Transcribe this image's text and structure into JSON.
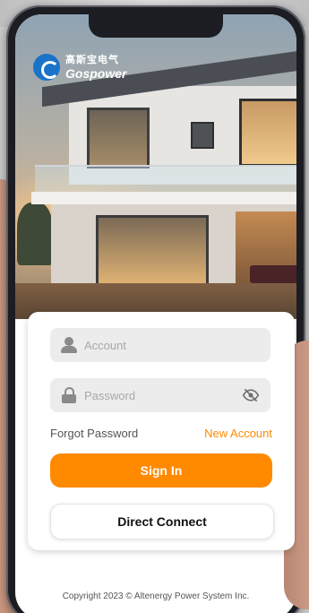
{
  "brand": {
    "name_cn": "高斯宝电气",
    "name_en": "Gospower"
  },
  "login": {
    "account_placeholder": "Account",
    "password_placeholder": "Password",
    "forgot_password": "Forgot Password",
    "new_account": "New Account",
    "sign_in": "Sign In",
    "direct_connect": "Direct Connect"
  },
  "footer": {
    "copyright": "Copyright 2023 © Altenergy Power System Inc."
  },
  "colors": {
    "accent": "#ff8a00",
    "logo_blue": "#1a73c8",
    "field_bg": "#ececec"
  },
  "icons": [
    "user-icon",
    "lock-icon",
    "eye-off-icon",
    "gospower-logo-icon"
  ]
}
